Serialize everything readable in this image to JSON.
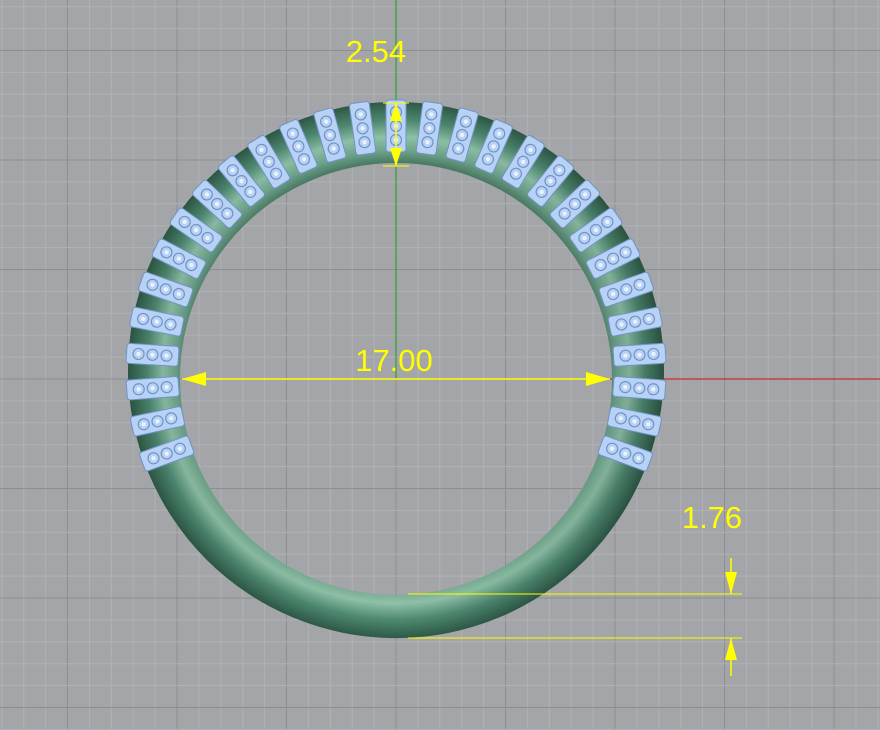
{
  "viewport": {
    "background_color": "#a3a5a8",
    "grid_minor_color": "#b0b2b5",
    "grid_major_color": "#8c8e91",
    "axis_x_color": "#d01010",
    "axis_y_color": "#18a018"
  },
  "model": {
    "type": "ring",
    "band_color": "#4f8a72",
    "band_highlight_color": "#8fc2a8",
    "band_shadow_color": "#2e5a47",
    "gem_setting_color": "#b8d2f5",
    "gem_setting_outline_color": "#6f93c8",
    "gem_settings_count": 29
  },
  "dimensions": {
    "color": "#ffff00",
    "band_width_top": "2.54",
    "inner_diameter": "17.00",
    "band_thickness_bottom": "1.76"
  }
}
